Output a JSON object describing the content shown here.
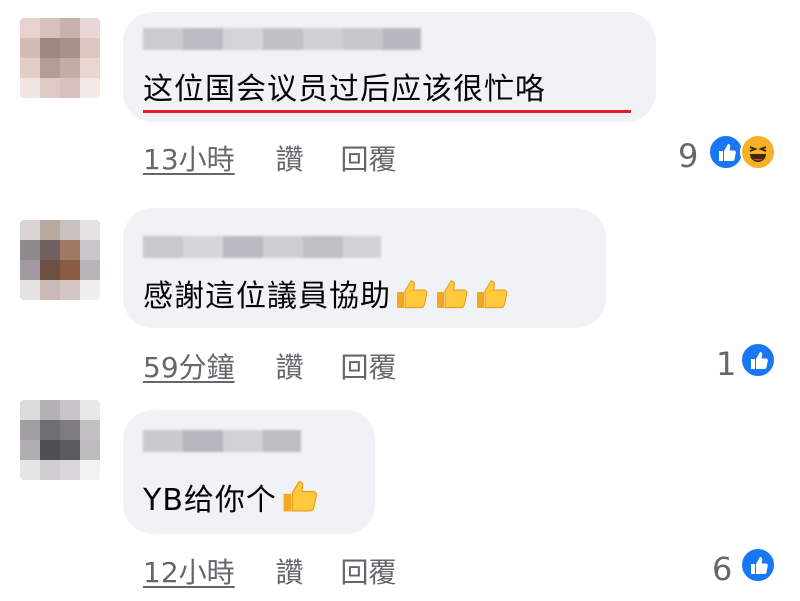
{
  "comments": [
    {
      "text": "这位国会议员过后应该很忙咯",
      "time": "13小時",
      "like_label": "讚",
      "reply_label": "回覆",
      "reaction_count": "9",
      "reactions": [
        "like-icon",
        "haha-icon"
      ]
    },
    {
      "text": "感謝這位議員協助",
      "emoji_count": 3,
      "time": "59分鐘",
      "like_label": "讚",
      "reply_label": "回覆",
      "reaction_count": "1",
      "reactions": [
        "like-icon"
      ]
    },
    {
      "text": "YB给你个",
      "emoji_count": 1,
      "time": "12小時",
      "like_label": "讚",
      "reply_label": "回覆",
      "reaction_count": "6",
      "reactions": [
        "like-icon"
      ]
    }
  ],
  "colors": {
    "bubble": "#f0f2f5",
    "meta_text": "#65676b",
    "like_blue": "#1877f2",
    "haha_yellow": "#f7b125",
    "underline_red": "#e41e26"
  }
}
